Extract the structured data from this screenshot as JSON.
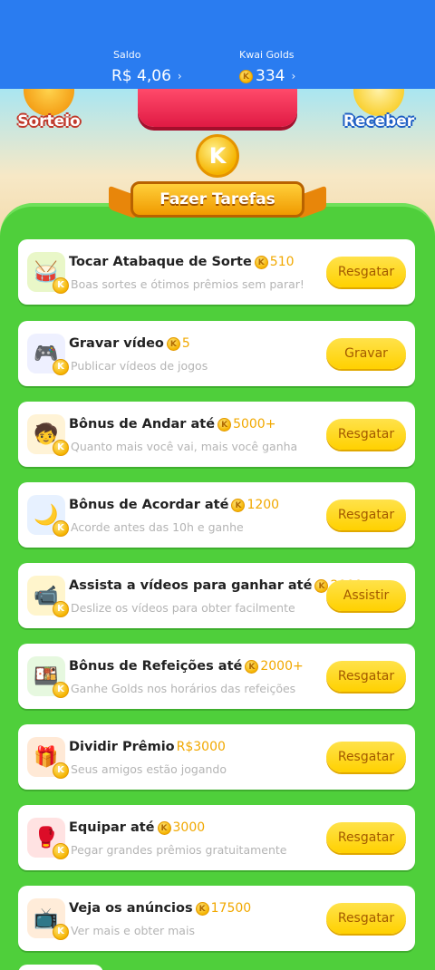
{
  "header": {
    "saldo_label": "Saldo",
    "saldo_value": "R$ 4,06",
    "golds_label": "Kwai Golds",
    "golds_value": "334"
  },
  "scene": {
    "left_badge": "Sorteio",
    "right_badge": "Receber"
  },
  "banner": {
    "coin_letter": "K",
    "title": "Fazer Tarefas"
  },
  "tasks": [
    {
      "title": "Tocar Atabaque de Sorte",
      "reward": "510",
      "reward_type": "coin",
      "subtitle": "Boas sortes e ótimos prêmios sem parar!",
      "button": "Resgatar",
      "icon": "drum-icon"
    },
    {
      "title": "Gravar vídeo",
      "reward": "5",
      "reward_type": "coin",
      "subtitle": "Publicar vídeos de jogos",
      "button": "Gravar",
      "icon": "game-controller-icon"
    },
    {
      "title": "Bônus de Andar até",
      "reward": "5000+",
      "reward_type": "coin",
      "subtitle": "Quanto mais você vai, mais você ganha",
      "button": "Resgatar",
      "icon": "walking-boy-icon"
    },
    {
      "title": "Bônus de Acordar até",
      "reward": "1200",
      "reward_type": "coin",
      "subtitle": "Acorde antes das 10h e ganhe",
      "button": "Resgatar",
      "icon": "moon-cloud-icon"
    },
    {
      "title": "Assista a vídeos para ganhar até",
      "reward": "2000",
      "reward_type": "coin",
      "subtitle": "Deslize os vídeos para obter facilmente",
      "button": "Assistir",
      "icon": "video-camera-icon"
    },
    {
      "title": "Bônus de Refeições até",
      "reward": "2000+",
      "reward_type": "coin",
      "subtitle": "Ganhe Golds nos horários das refeições",
      "button": "Resgatar",
      "icon": "meal-box-icon"
    },
    {
      "title": "Dividir Prêmio",
      "reward": "R$3000",
      "reward_type": "money",
      "subtitle": "Seus amigos estão jogando",
      "button": "Resgatar",
      "icon": "gift-box-icon"
    },
    {
      "title": "Equipar até",
      "reward": "3000",
      "reward_type": "coin",
      "subtitle": "Pegar grandes prêmios gratuitamente",
      "button": "Resgatar",
      "icon": "boxing-gloves-icon"
    },
    {
      "title": "Veja os anúncios",
      "reward": "17500",
      "reward_type": "coin",
      "subtitle": "Ver mais e obter mais",
      "button": "Resgatar",
      "icon": "tv-ad-icon"
    }
  ],
  "colors": {
    "header_blue": "#2a7cf0",
    "panel_green": "#4fcf3b",
    "button_yellow": "#ffd100",
    "reward_gold": "#f1a800"
  }
}
